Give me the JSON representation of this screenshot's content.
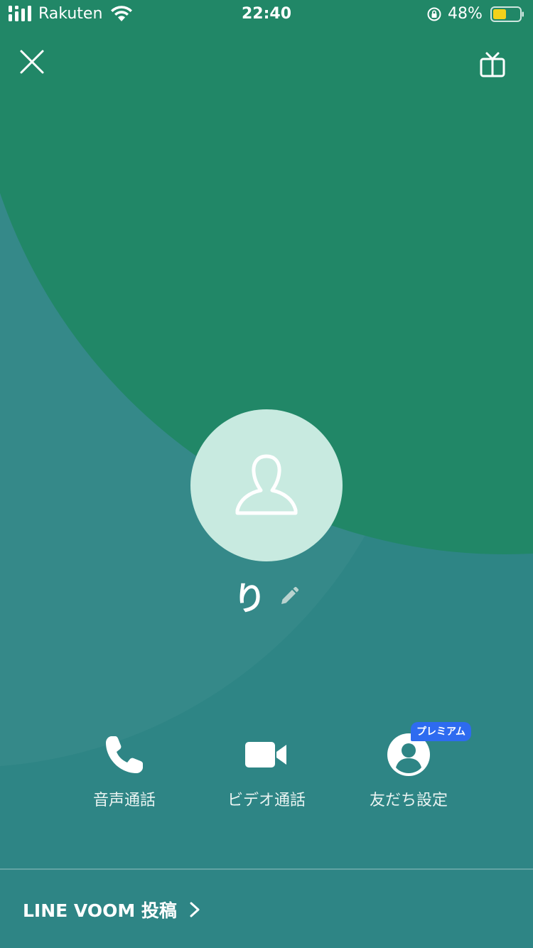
{
  "status_bar": {
    "carrier": "Rakuten",
    "time": "22:40",
    "battery_percent": "48%"
  },
  "profile": {
    "name": "り"
  },
  "actions": [
    {
      "label": "音声通話",
      "icon": "phone-icon"
    },
    {
      "label": "ビデオ通話",
      "icon": "video-camera-icon"
    },
    {
      "label": "友だち設定",
      "icon": "friend-settings-icon"
    }
  ],
  "premium_badge": "プレミアム",
  "footer": {
    "voom_label": "LINE VOOM 投稿"
  },
  "colors": {
    "green_background": "#218767",
    "teal_background": "#2E8585",
    "avatar_background": "#C8EAE0",
    "badge_blue": "#2E6BF0",
    "battery_yellow": "#F2D21A"
  }
}
